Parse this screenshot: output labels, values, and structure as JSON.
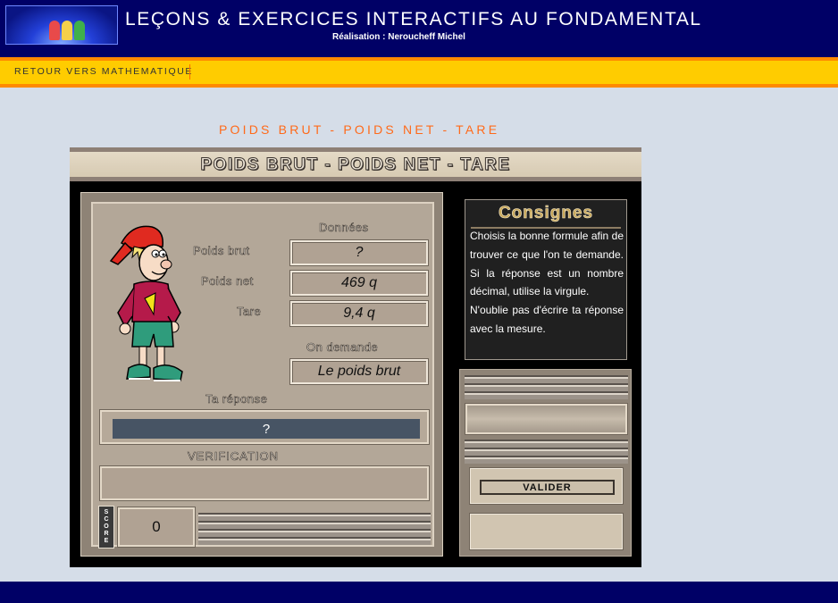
{
  "header": {
    "title": "LEÇONS & EXERCICES INTERACTIFS AU FONDAMENTAL",
    "subtitle": "Réalisation : Neroucheff Michel"
  },
  "nav": {
    "back_link": "RETOUR VERS MATHEMATIQUE"
  },
  "page": {
    "title": "POIDS BRUT - POIDS NET - TARE"
  },
  "applet": {
    "banner_title": "POIDS BRUT - POIDS NET - TARE",
    "donnees_label": "Données",
    "poids_brut_label": "Poids brut",
    "poids_brut_value": "?",
    "poids_net_label": "Poids net",
    "poids_net_value": "469 q",
    "tare_label": "Tare",
    "tare_value": "9,4 q",
    "on_demande_label": "On demande",
    "on_demande_value": "Le poids brut",
    "ta_reponse_label": "Ta réponse",
    "answer_value": "?",
    "verification_label": "VERIFICATION",
    "verification_value": "",
    "score_letters": [
      "S",
      "C",
      "O",
      "R",
      "E"
    ],
    "score_value": "0",
    "validate_label": "VALIDER",
    "display_value": "",
    "message_value": ""
  },
  "consignes": {
    "title": "Consignes",
    "paragraph1": "Choisis la bonne formule afin de trouver ce que l'on te demande. Si la réponse est un nombre décimal, utilise la virgule.",
    "paragraph2": "N'oublie pas d'écrire ta réponse avec la mesure."
  },
  "colors": {
    "header_bg": "#000066",
    "nav_bg": "#ffcc00",
    "nav_border": "#ff8a00",
    "page_title": "#ff6a1a",
    "page_bg": "#d5dde8",
    "answer_bg": "#475464"
  }
}
